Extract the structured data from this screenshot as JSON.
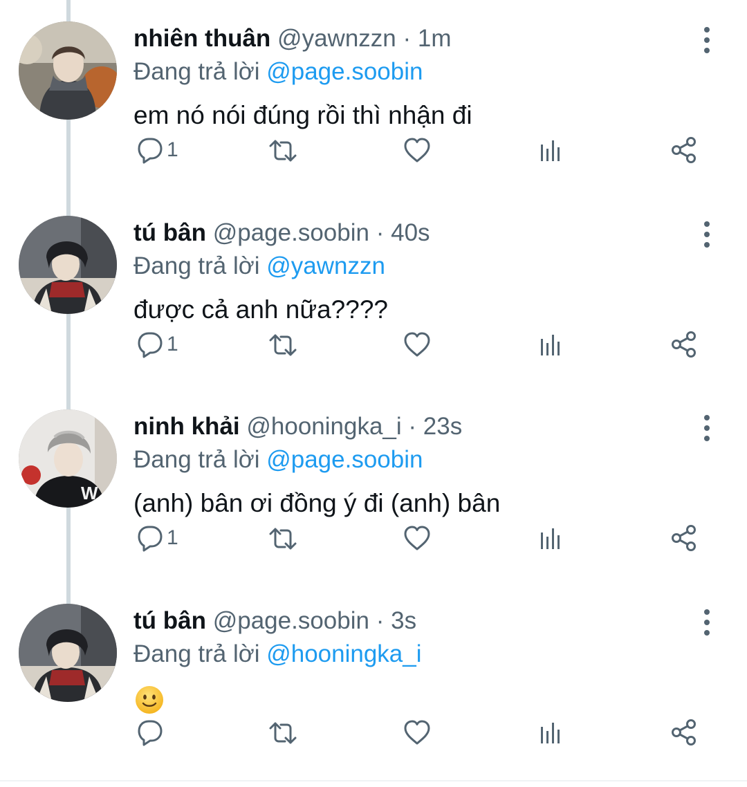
{
  "tweets": [
    {
      "name": "nhiên thuân",
      "handle": "@yawnzzn",
      "separator": "·",
      "time": "1m",
      "replying_label": "Đang trả lời",
      "replying_to": "@page.soobin",
      "text": "em nó nói đúng rồi thì nhận đi",
      "reply_count": "1"
    },
    {
      "name": "tú bân",
      "handle": "@page.soobin",
      "separator": "·",
      "time": "40s",
      "replying_label": "Đang trả lời",
      "replying_to": "@yawnzzn",
      "text": "được cả anh nữa????",
      "reply_count": "1"
    },
    {
      "name": "ninh khải",
      "handle": "@hooningka_i",
      "separator": "·",
      "time": "23s",
      "replying_label": "Đang trả lời",
      "replying_to": "@page.soobin",
      "text": "(anh) bân ơi đồng ý đi (anh) bân",
      "reply_count": "1"
    },
    {
      "name": "tú bân",
      "handle": "@page.soobin",
      "separator": "·",
      "time": "3s",
      "replying_label": "Đang trả lời",
      "replying_to": "@hooningka_i",
      "text": "",
      "emoji": "slightly-smiling-face",
      "reply_count": ""
    }
  ],
  "colors": {
    "accent": "#1d9bf0",
    "secondary_text": "#536471",
    "thread_line": "#cfd9de"
  },
  "icons": [
    "reply-icon",
    "retweet-icon",
    "like-icon",
    "views-icon",
    "share-icon",
    "more-icon"
  ]
}
